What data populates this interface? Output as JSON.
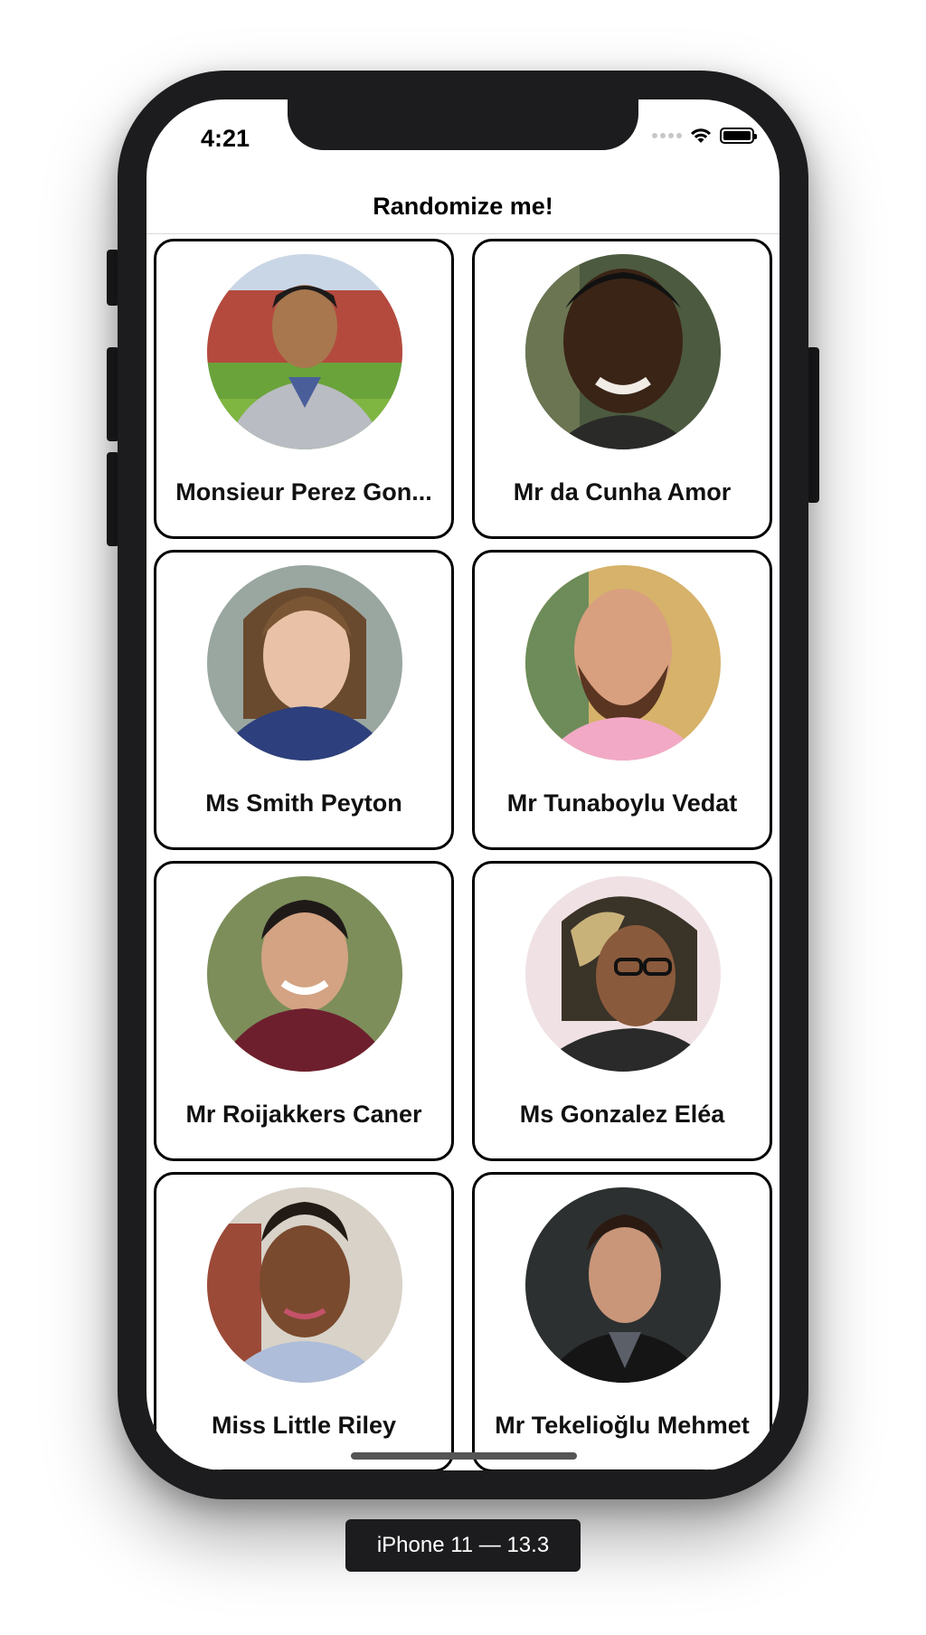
{
  "status_bar": {
    "time": "4:21"
  },
  "nav": {
    "title": "Randomize me!"
  },
  "people": [
    {
      "name": "Monsieur Perez Gon...",
      "avatar": "man-with-beard-outdoors"
    },
    {
      "name": "Mr da Cunha Amor",
      "avatar": "smiling-man"
    },
    {
      "name": "Ms Smith Peyton",
      "avatar": "young-woman"
    },
    {
      "name": "Mr Tunaboylu Vedat",
      "avatar": "bearded-man-pink-shirt"
    },
    {
      "name": "Mr Roijakkers Caner",
      "avatar": "smiling-young-man"
    },
    {
      "name": "Ms Gonzalez Eléa",
      "avatar": "woman-with-glasses"
    },
    {
      "name": "Miss Little Riley",
      "avatar": "smiling-woman"
    },
    {
      "name": "Mr Tekelioğlu Mehmet",
      "avatar": "man-dark-background"
    }
  ],
  "device": {
    "label": "iPhone 11 — 13.3"
  }
}
